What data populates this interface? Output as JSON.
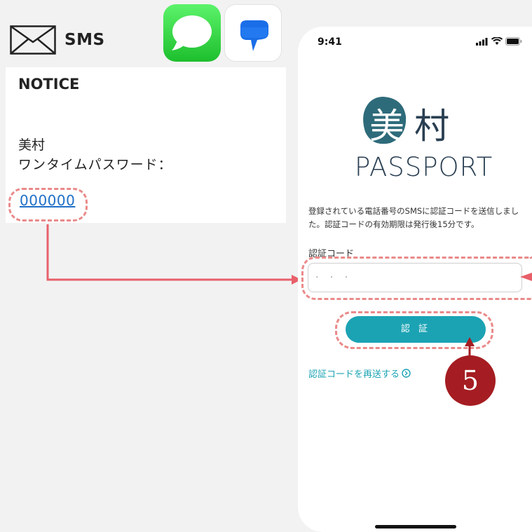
{
  "header": {
    "title": "SMS",
    "icons": [
      "envelope-icon",
      "apple-messages-app-icon",
      "google-messages-app-icon"
    ]
  },
  "sms_card": {
    "notice_title": "NOTICE",
    "sender": "美村",
    "body": "ワンタイムパスワード：",
    "code": "000000"
  },
  "phone": {
    "status_time": "9:41",
    "logo": {
      "kanji_1": "美",
      "kanji_2": "村",
      "wordmark": "PASSPORT"
    },
    "instruction": "登録されている電話番号のSMSに認証コードを送信しました。認証コードの有効期限は発行後15分です。",
    "code_label": "認証コード",
    "code_input_placeholder": "· · ·",
    "verify_button_label": "認 証",
    "resend_link_label": "認証コードを再送する"
  },
  "annotation": {
    "step_number": "5"
  },
  "colors": {
    "highlight": "#ea8a8a",
    "arrow": "#e8606a",
    "teal": "#1ba3b4",
    "badge": "#a51d22",
    "link": "#1f6fc7"
  }
}
